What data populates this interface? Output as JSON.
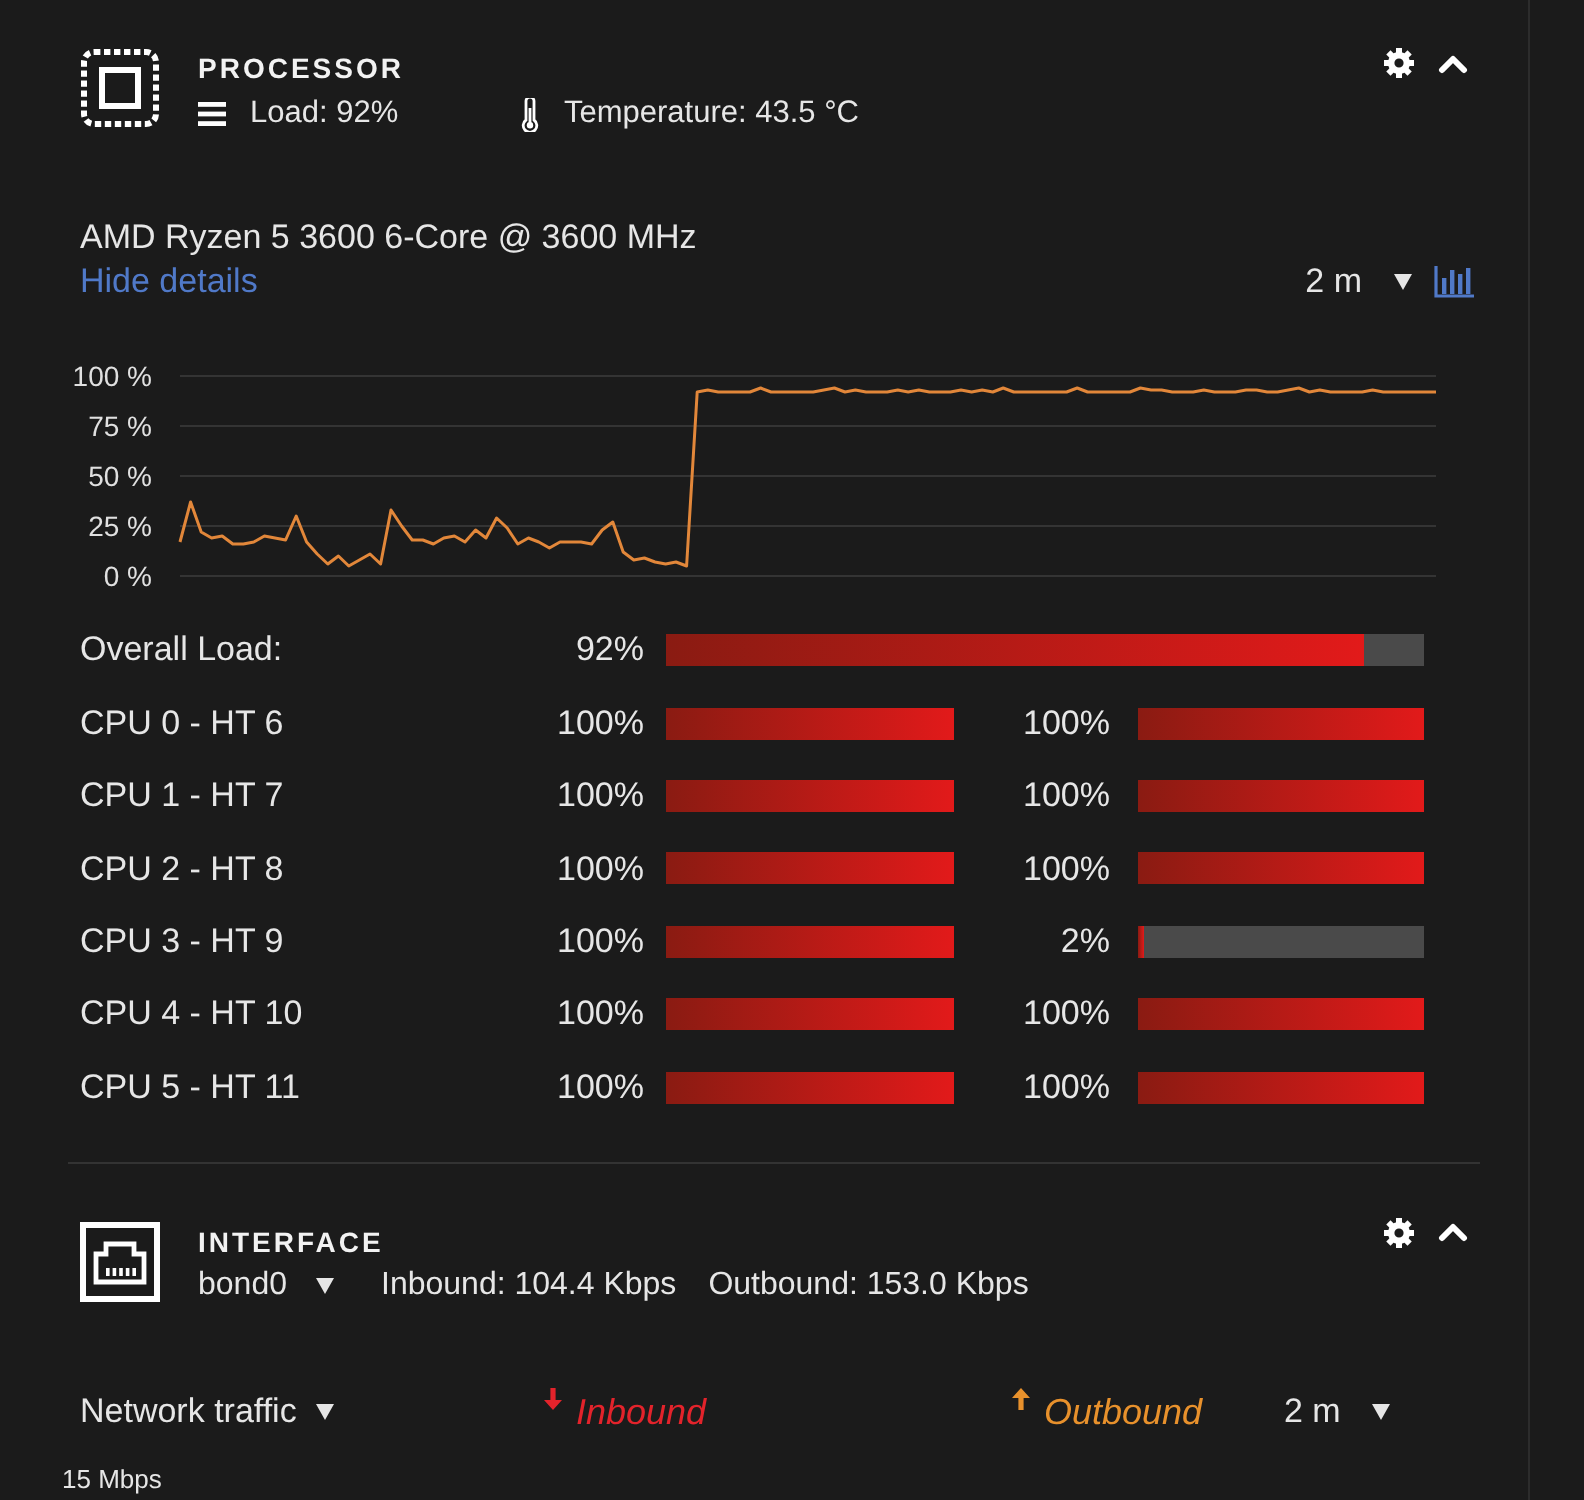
{
  "processor": {
    "title": "PROCESSOR",
    "load": "Load: 92%",
    "temperature": "Temperature: 43.5 °C",
    "expanded": true,
    "model": "AMD Ryzen 5 3600 6-Core @ 3600 MHz",
    "details_link": "Hide details",
    "range": "2 m",
    "chart_data": {
      "type": "line",
      "grid": true,
      "ylim": [
        0,
        100
      ],
      "yticks": [
        {
          "value": 0,
          "label": "0 %"
        },
        {
          "value": 25,
          "label": "25 %"
        },
        {
          "value": 50,
          "label": "50 %"
        },
        {
          "value": 75,
          "label": "75 %"
        },
        {
          "value": 100,
          "label": "100 %"
        }
      ],
      "series": [
        {
          "color": "#e2873a",
          "values": [
            17,
            37,
            22,
            19,
            20,
            16,
            16,
            17,
            20,
            19,
            18,
            30,
            17,
            11,
            6,
            10,
            5,
            8,
            11,
            6,
            33,
            25,
            18,
            18,
            16,
            19,
            20,
            17,
            23,
            19,
            29,
            24,
            16,
            19,
            17,
            14,
            17,
            17,
            17,
            16,
            23,
            27,
            12,
            8,
            9,
            7,
            6,
            7,
            5,
            92,
            93,
            92,
            92,
            92,
            92,
            94,
            92,
            92,
            92,
            92,
            92,
            93,
            94,
            92,
            93,
            92,
            92,
            92,
            93,
            92,
            93,
            92,
            92,
            92,
            93,
            92,
            93,
            92,
            94,
            92,
            92,
            92,
            92,
            92,
            92,
            94,
            92,
            92,
            92,
            92,
            92,
            94,
            93,
            93,
            92,
            92,
            92,
            93,
            92,
            92,
            92,
            93,
            93,
            92,
            92,
            93,
            94,
            92,
            93,
            92,
            92,
            92,
            92,
            93,
            92,
            92,
            92,
            92,
            92,
            92
          ]
        }
      ]
    },
    "overall": {
      "label": "Overall Load:",
      "reading": "92%",
      "level": 0.92
    },
    "cores": [
      {
        "label": "CPU 0 - HT 6",
        "threads": [
          {
            "reading": "100%",
            "level": 1
          },
          {
            "reading": "100%",
            "level": 1
          }
        ]
      },
      {
        "label": "CPU 1 - HT 7",
        "threads": [
          {
            "reading": "100%",
            "level": 1
          },
          {
            "reading": "100%",
            "level": 1
          }
        ]
      },
      {
        "label": "CPU 2 - HT 8",
        "threads": [
          {
            "reading": "100%",
            "level": 1
          },
          {
            "reading": "100%",
            "level": 1
          }
        ]
      },
      {
        "label": "CPU 3 - HT 9",
        "threads": [
          {
            "reading": "100%",
            "level": 1
          },
          {
            "reading": "2%",
            "level": 0.02
          }
        ]
      },
      {
        "label": "CPU 4 - HT 10",
        "threads": [
          {
            "reading": "100%",
            "level": 1
          },
          {
            "reading": "100%",
            "level": 1
          }
        ]
      },
      {
        "label": "CPU 5 - HT 11",
        "threads": [
          {
            "reading": "100%",
            "level": 1
          },
          {
            "reading": "100%",
            "level": 1
          }
        ]
      }
    ]
  },
  "interface": {
    "title": "INTERFACE",
    "expanded": true,
    "name": "bond0",
    "inbound": "Inbound: 104.4 Kbps",
    "outbound": "Outbound: 153.0 Kbps",
    "graph": "Network traffic",
    "legend": [
      {
        "kind": "inbound",
        "label": "Inbound",
        "color": "#e3232b"
      },
      {
        "kind": "outbound",
        "label": "Outbound",
        "color": "#e8912c"
      }
    ],
    "range": "2 m",
    "axis_label": "15 Mbps"
  }
}
